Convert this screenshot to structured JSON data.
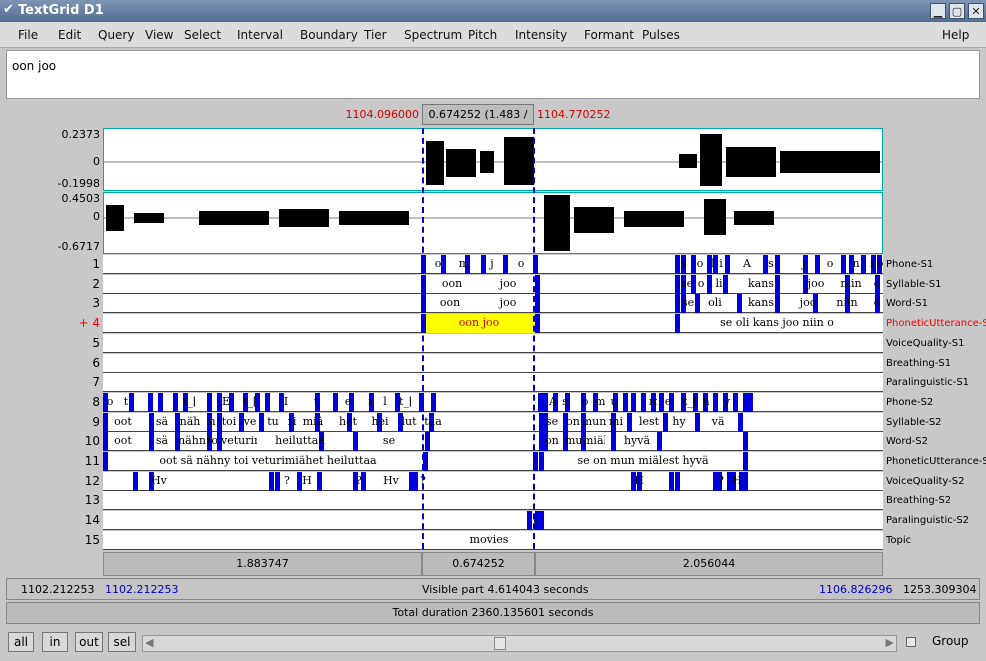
{
  "window": {
    "title": "TextGrid D1",
    "minimize": "▁",
    "maximize": "▢",
    "close": "✕"
  },
  "menu": [
    "File",
    "Edit",
    "Query",
    "View",
    "Select",
    "Interval",
    "Boundary",
    "Tier",
    "Spectrum",
    "Pitch",
    "Intensity",
    "Formant",
    "Pulses"
  ],
  "help": "Help",
  "text_value": "oon joo",
  "selection": {
    "start": "1104.096000",
    "duration": "0.674252 (1.483 / s)",
    "end": "1104.770252"
  },
  "channel1": {
    "max": "0.2373",
    "zero": "0",
    "min": "-0.1998"
  },
  "channel2": {
    "max": "0.4503",
    "zero": "0",
    "min": "-0.6717"
  },
  "tiers": [
    {
      "num": "1",
      "name": "Phone-S1",
      "current": false,
      "segs": [
        {
          "t": "o"
        },
        {
          "t": "m"
        },
        {
          "t": "j"
        },
        {
          "t": "o"
        },
        {
          "t": "s"
        },
        {
          "t": "o"
        },
        {
          "t": "l"
        },
        {
          "t": "i"
        },
        {
          "t": "A"
        },
        {
          "t": "s"
        },
        {
          "t": "j"
        },
        {
          "t": "o"
        },
        {
          "t": "n"
        },
        {
          "t": "i"
        },
        {
          "t": "o"
        }
      ]
    },
    {
      "num": "2",
      "name": "Syllable-S1",
      "current": false,
      "segs": [
        {
          "t": "oon"
        },
        {
          "t": "joo"
        },
        {
          "t": "se"
        },
        {
          "t": "o"
        },
        {
          "t": "li"
        },
        {
          "t": "kans"
        },
        {
          "t": "joo"
        },
        {
          "t": "niin"
        },
        {
          "t": "o"
        }
      ]
    },
    {
      "num": "3",
      "name": "Word-S1",
      "current": false,
      "segs": [
        {
          "t": "oon"
        },
        {
          "t": "joo"
        },
        {
          "t": "se"
        },
        {
          "t": "oli"
        },
        {
          "t": "kans"
        },
        {
          "t": "joo"
        },
        {
          "t": "niin"
        },
        {
          "t": "o"
        }
      ]
    },
    {
      "num": "+ 4",
      "name": "PhoneticUtterance-S1",
      "current": true,
      "segs": [
        {
          "t": "oon joo"
        },
        {
          "t": "se oli kans joo niin o"
        }
      ]
    },
    {
      "num": "5",
      "name": "VoiceQuality-S1",
      "current": false,
      "segs": []
    },
    {
      "num": "6",
      "name": "Breathing-S1",
      "current": false,
      "segs": []
    },
    {
      "num": "7",
      "name": "Paralinguistic-S1",
      "current": false,
      "segs": []
    },
    {
      "num": "8",
      "name": "Phone-S2",
      "current": false,
      "segs": [
        {
          "t": "o"
        },
        {
          "t": "t"
        },
        {
          "t": "t_["
        },
        {
          "t": "E"
        },
        {
          "t": "t_[r"
        },
        {
          "t": "I"
        },
        {
          "t": "t"
        },
        {
          "t": "e"
        },
        {
          "t": "i"
        },
        {
          "t": "l"
        },
        {
          "t": "t_["
        },
        {
          "t": "A"
        },
        {
          "t": "s"
        },
        {
          "t": "o"
        },
        {
          "t": "m"
        },
        {
          "t": "u"
        },
        {
          "t": "m"
        },
        {
          "t": "e"
        },
        {
          "t": "t_["
        },
        {
          "t": "h"
        },
        {
          "t": "y"
        },
        {
          "t": "V"
        },
        {
          "t": "@"
        }
      ]
    },
    {
      "num": "9",
      "name": "Syllable-S2",
      "current": false,
      "segs": [
        {
          "t": "oot"
        },
        {
          "t": "sä"
        },
        {
          "t": "näh"
        },
        {
          "t": "n"
        },
        {
          "t": "toi"
        },
        {
          "t": "ve"
        },
        {
          "t": "tu"
        },
        {
          "t": "ri"
        },
        {
          "t": "miä"
        },
        {
          "t": "het"
        },
        {
          "t": "hei"
        },
        {
          "t": "lut"
        },
        {
          "t": "taa"
        },
        {
          "t": "se"
        },
        {
          "t": "on"
        },
        {
          "t": "mun"
        },
        {
          "t": "mi"
        },
        {
          "t": "lest"
        },
        {
          "t": "hy"
        },
        {
          "t": "vä"
        }
      ]
    },
    {
      "num": "10",
      "name": "Word-S2",
      "current": false,
      "segs": [
        {
          "t": "oot"
        },
        {
          "t": "sä"
        },
        {
          "t": "nähn"
        },
        {
          "t": "toi"
        },
        {
          "t": "veturimiähet"
        },
        {
          "t": "heiluttaa"
        },
        {
          "t": "se"
        },
        {
          "t": "on"
        },
        {
          "t": "mun"
        },
        {
          "t": "miälest"
        },
        {
          "t": "hyvä"
        }
      ]
    },
    {
      "num": "11",
      "name": "PhoneticUtterance-S2",
      "current": false,
      "segs": [
        {
          "t": "oot sä nähny toi veturimiähet heiluttaa"
        },
        {
          "t": "se on mun miälest hyvä"
        }
      ]
    },
    {
      "num": "12",
      "name": "VoiceQuality-S2",
      "current": false,
      "segs": [
        {
          "t": "Hv"
        },
        {
          "t": "?"
        },
        {
          "t": "H"
        },
        {
          "t": "?"
        },
        {
          "t": "Hv"
        },
        {
          "t": "?"
        },
        {
          "t": "H"
        },
        {
          "t": "?"
        },
        {
          "t": "H"
        }
      ]
    },
    {
      "num": "13",
      "name": "Breathing-S2",
      "current": false,
      "segs": []
    },
    {
      "num": "14",
      "name": "Paralinguistic-S2",
      "current": false,
      "segs": [
        {
          "t": "t"
        }
      ]
    },
    {
      "num": "15",
      "name": "Topic",
      "current": false,
      "segs": [
        {
          "t": "movies"
        }
      ]
    }
  ],
  "durations": [
    "1.883747",
    "0.674252",
    "2.056044"
  ],
  "visible": {
    "left_total": "1102.212253",
    "start": "1102.212253",
    "label": "Visible part 4.614043 seconds",
    "end": "1106.826296",
    "right_total": "1253.309304"
  },
  "total": "Total duration 2360.135601 seconds",
  "buttons": {
    "all": "all",
    "in": "in",
    "out": "out",
    "sel": "sel",
    "group": "Group"
  },
  "colors": {
    "accent": "#0000dd",
    "current_tier": "#ff0000",
    "highlight": "#ffff00"
  }
}
